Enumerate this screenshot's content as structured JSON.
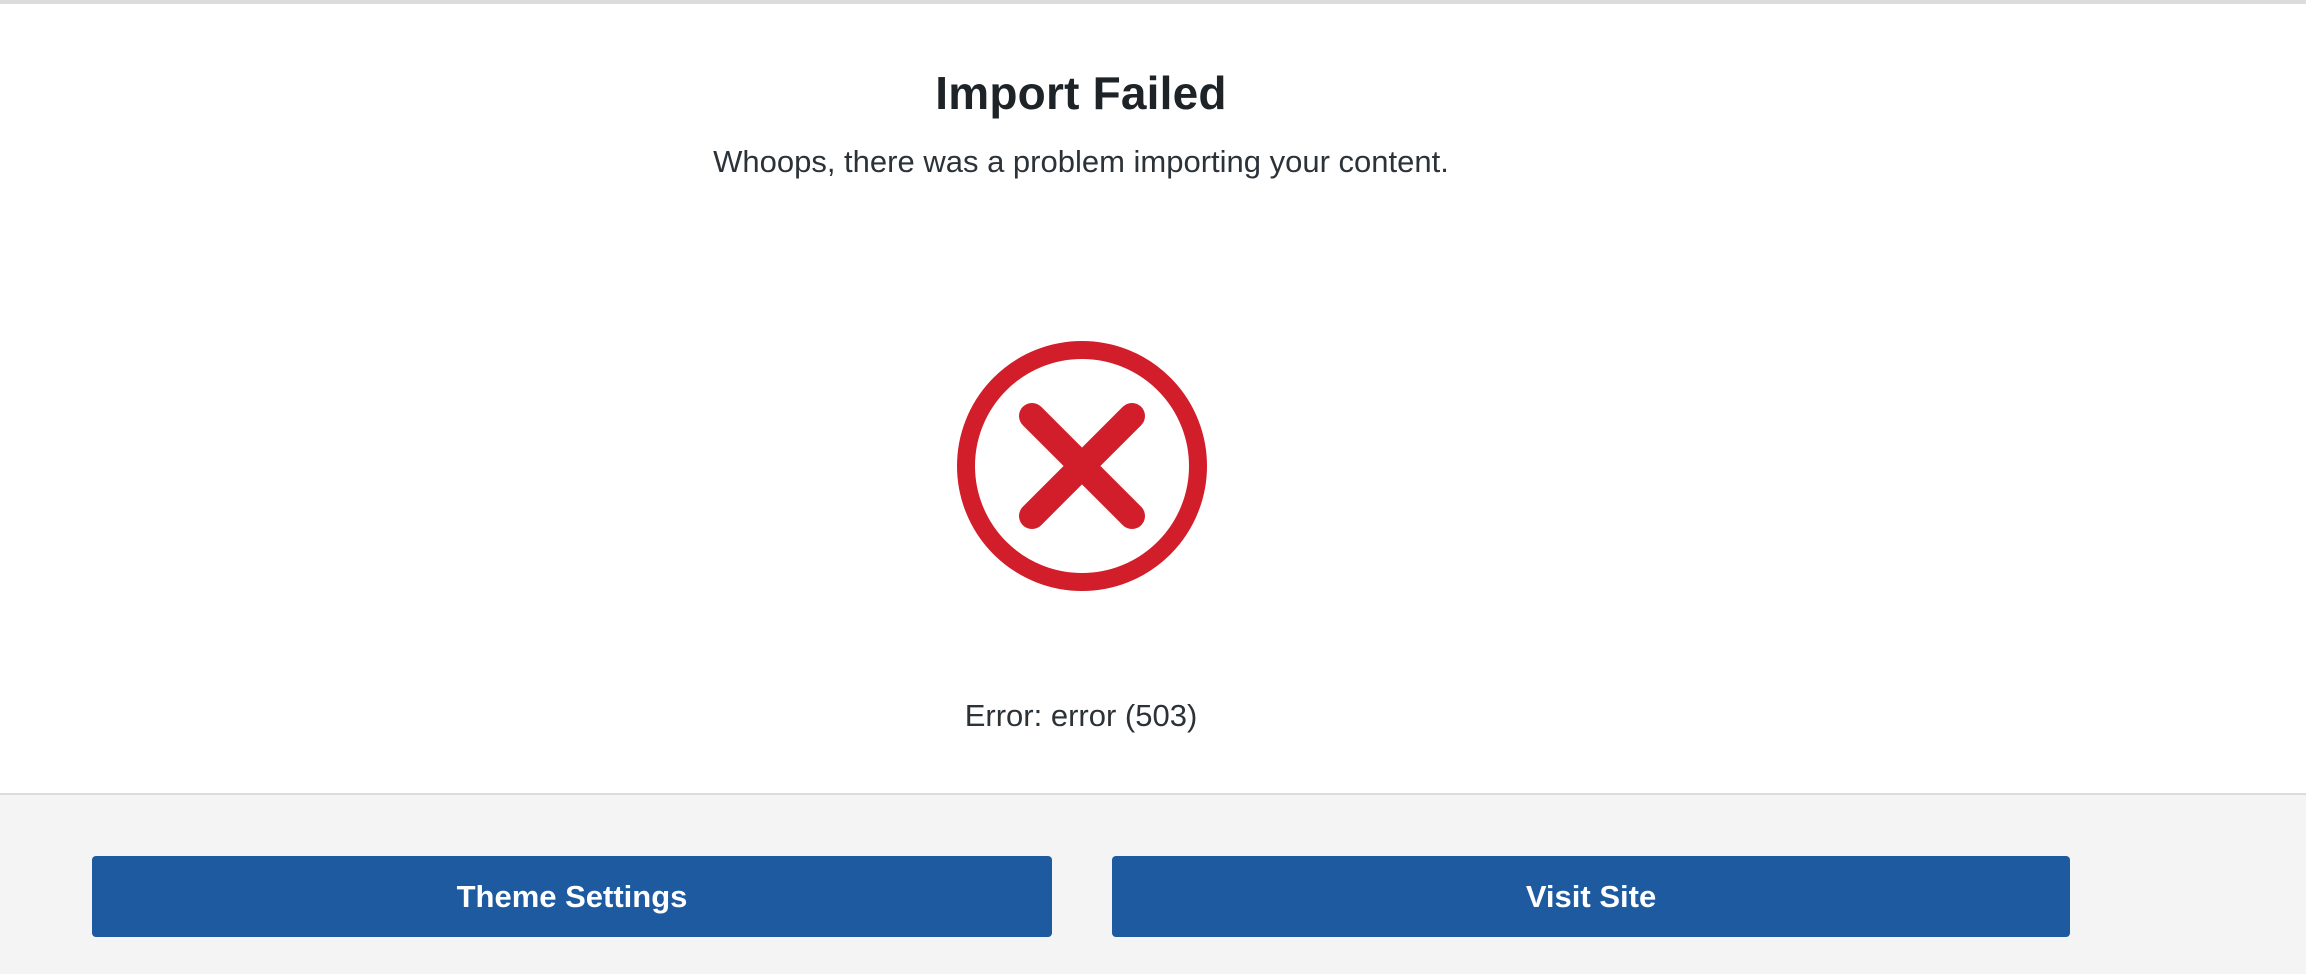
{
  "header": {
    "title": "Import Failed",
    "subtitle": "Whoops, there was a problem importing your content."
  },
  "status": {
    "icon": "error-x-circle-icon",
    "color": "#d21e2b",
    "message": "Error: error (503)"
  },
  "footer": {
    "theme_settings_label": "Theme Settings",
    "visit_site_label": "Visit Site",
    "button_color": "#1e5aa0"
  }
}
